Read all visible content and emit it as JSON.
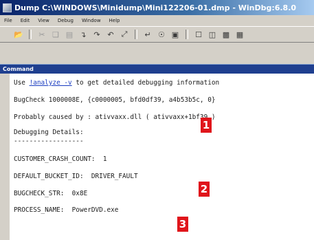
{
  "window": {
    "title": "Dump C:\\WINDOWS\\Minidump\\Mini122206-01.dmp - WinDbg:6.8.0"
  },
  "menubar": {
    "items": [
      "File",
      "Edit",
      "View",
      "Debug",
      "Window",
      "Help"
    ]
  },
  "toolbar": {
    "icons": [
      "open-icon",
      "cut-icon",
      "copy-icon",
      "paste-icon",
      "go-icon",
      "step-into-icon",
      "step-over-icon",
      "step-out-icon",
      "run-to-cursor-icon",
      "breakpoint-icon",
      "command-window-icon",
      "watch-window-icon",
      "locals-window-icon",
      "registers-window-icon"
    ]
  },
  "pane": {
    "title": "Command"
  },
  "output": {
    "line1_prefix": "Use ",
    "line1_link": "!analyze -v",
    "line1_suffix": " to get detailed debugging information",
    "bugcheck": "BugCheck 1000008E, {c0000005, bfd0df39, a4b53b5c, 0}",
    "probably_caused": "Probably caused by : ativvaxx.dll ( ativvaxx+1bf39 )",
    "debugging_details": "Debugging Details:",
    "underline": "------------------",
    "crash_count": "CUSTOMER_CRASH_COUNT:  1",
    "bucket_id": "DEFAULT_BUCKET_ID:  DRIVER_FAULT",
    "bugcheck_str": "BUGCHECK_STR:  0x8E",
    "process_name": "PROCESS_NAME:  PowerDVD.exe"
  },
  "annotations": {
    "badge1": "1",
    "badge2": "2",
    "badge3": "3"
  },
  "colors": {
    "badge": "#e0151b",
    "pane_header": "#1f3f8f",
    "link": "#1a3cc0"
  }
}
